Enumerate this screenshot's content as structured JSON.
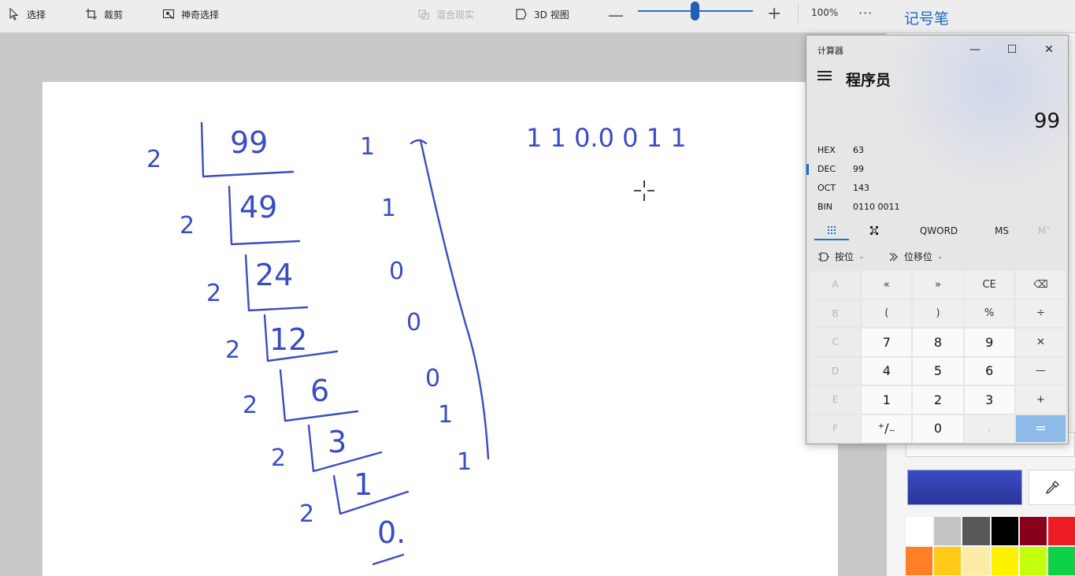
{
  "toolbar": {
    "select_label": "选择",
    "crop_label": "裁剪",
    "magic_select_label": "神奇选择",
    "mixed_reality_label": "混合现实",
    "view3d_label": "3D 视图",
    "zoom_minus": "—",
    "zoom_plus": "+",
    "zoom_level_percent": 48,
    "zoom_value": "100%",
    "more": "···"
  },
  "side_panel": {
    "title": "记号笔",
    "selected_color": "#3a4cc4",
    "swatches": [
      "#ffffff",
      "#c3c3c3",
      "#585858",
      "#000000",
      "#88001b",
      "#ec1c24",
      "#ff7f27",
      "#ffca18",
      "#fdeca6",
      "#fff200",
      "#c4ff0e",
      "#0ed145"
    ]
  },
  "drawing": {
    "ink_color": "#3a4cc4",
    "quotients": [
      "99",
      "49",
      "24",
      "12",
      "6",
      "3",
      "1",
      "0."
    ],
    "divisors": [
      "2",
      "2",
      "2",
      "2",
      "2",
      "2",
      "2"
    ],
    "remainders": [
      "1",
      "1",
      "0",
      "0",
      "0",
      "1",
      "1"
    ],
    "result": "1 1 0.0 0 1 1"
  },
  "calculator": {
    "title": "计算器",
    "minimize": "—",
    "maximize": "☐",
    "close": "✕",
    "mode": "程序员",
    "display": "99",
    "radix": [
      {
        "name": "HEX",
        "value": "63",
        "active": false
      },
      {
        "name": "DEC",
        "value": "99",
        "active": true
      },
      {
        "name": "OCT",
        "value": "143",
        "active": false
      },
      {
        "name": "BIN",
        "value": "0110 0011",
        "active": false
      }
    ],
    "tabs": {
      "word_size": "QWORD",
      "ms": "MS",
      "mr": "M˅"
    },
    "bitwise": "按位",
    "bitshift": "位移位",
    "keys": [
      [
        "A",
        "«",
        "»",
        "CE",
        "⌫"
      ],
      [
        "B",
        "(",
        ")",
        "%",
        "÷"
      ],
      [
        "C",
        "7",
        "8",
        "9",
        "✕"
      ],
      [
        "D",
        "4",
        "5",
        "6",
        "—"
      ],
      [
        "E",
        "1",
        "2",
        "3",
        "+"
      ],
      [
        "F",
        "⁺∕₋",
        "0",
        ".",
        "="
      ]
    ]
  }
}
